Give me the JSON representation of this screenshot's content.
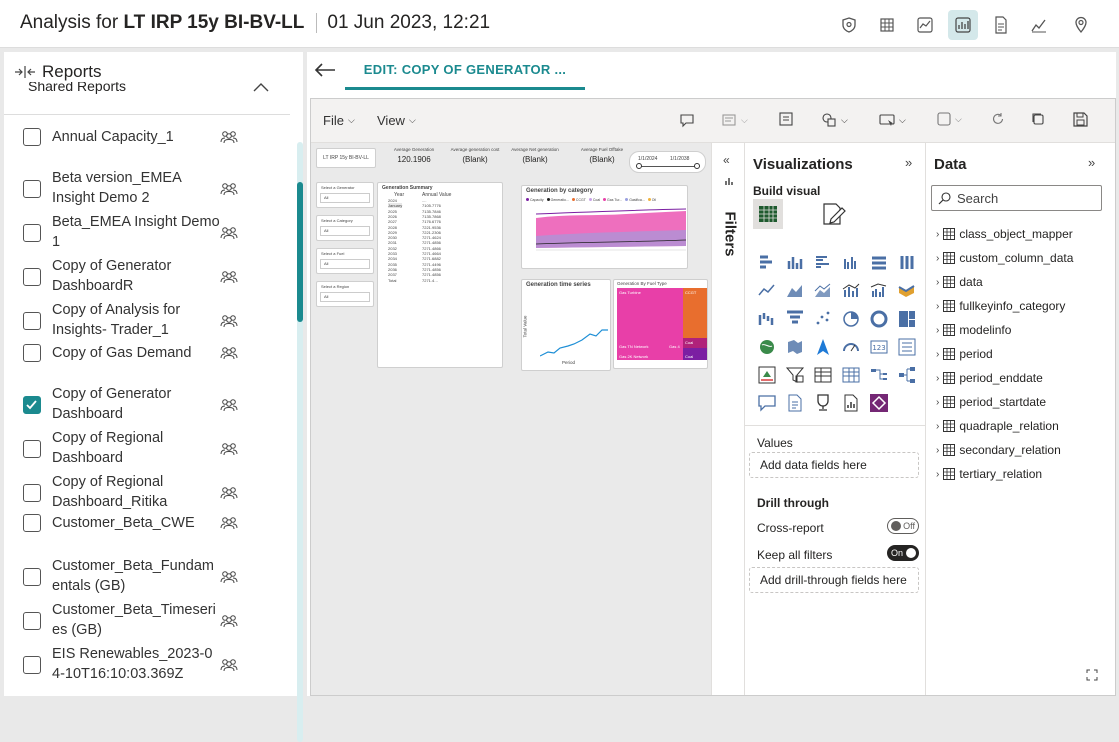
{
  "header": {
    "title_prefix": "Analysis for ",
    "title_bold": "LT IRP 15y BI-BV-LL",
    "timestamp": "01 Jun 2023, 12:21",
    "icons": [
      "shield-pin-icon",
      "table-icon",
      "chart-box-icon",
      "dashboard-icon",
      "document-icon",
      "line-chart-icon",
      "map-pin-icon"
    ]
  },
  "sidebar": {
    "title": "Reports",
    "section": "Shared Reports",
    "items": [
      {
        "label": "Annual Capacity_1",
        "checked": false
      },
      {
        "label": "Beta version_EMEA Insight Demo 2",
        "checked": false
      },
      {
        "label": "Beta_EMEA Insight Demo 1",
        "checked": false
      },
      {
        "label": "Copy of Generator DashboardR",
        "checked": false
      },
      {
        "label": "Copy of Analysis for Insights- Trader_1",
        "checked": false
      },
      {
        "label": "Copy of Gas Demand",
        "checked": false
      },
      {
        "label": "Copy of Generator Dashboard",
        "checked": true
      },
      {
        "label": "Copy of Regional Dashboard",
        "checked": false
      },
      {
        "label": "Copy of Regional Dashboard_Ritika",
        "checked": false
      },
      {
        "label": "Customer_Beta_CWE",
        "checked": false
      },
      {
        "label": "Customer_Beta_Fundamentals (GB)",
        "checked": false
      },
      {
        "label": "Customer_Beta_Timeseries (GB)",
        "checked": false
      },
      {
        "label": "EIS Renewables_2023-04-10T16:10:03.369Z",
        "checked": false
      }
    ]
  },
  "main": {
    "tab_label": "EDIT: COPY OF GENERATOR ...",
    "menu": {
      "file": "File",
      "view": "View"
    },
    "canvas": {
      "report_title": "LT IRP 15y BI-BV-LL",
      "kpis": [
        {
          "label": "Average Generation",
          "value": "120.1906"
        },
        {
          "label": "Average generation cost",
          "value": "(Blank)"
        },
        {
          "label": "Average Net generation",
          "value": "(Blank)"
        },
        {
          "label": "Average Fuel Offtake",
          "value": "(Blank)"
        }
      ],
      "date_from": "1/1/2024",
      "date_to": "1/1/2038",
      "slicers": [
        "Select a Generator",
        "Select a Category",
        "Select a Fuel",
        "Select a Region"
      ],
      "slicer_value": "All",
      "summary_title": "Generation Summary",
      "summary_cols": [
        "Year",
        "Annual Value"
      ],
      "summary_rows": [
        [
          "2024",
          "...."
        ],
        [
          "January",
          "7105.7776"
        ],
        [
          "2025",
          "7135.7846"
        ],
        [
          "2026",
          "7135.7868"
        ],
        [
          "2027",
          "7176.6776"
        ],
        [
          "2028",
          "7221.9536"
        ],
        [
          "2029",
          "7221.2306"
        ],
        [
          "2030",
          "7271.4624"
        ],
        [
          "2031",
          "7271.4856"
        ],
        [
          "2032",
          "7271.4866"
        ],
        [
          "2033",
          "7271.4664"
        ],
        [
          "2034",
          "7271.6882"
        ],
        [
          "2035",
          "7271.4496"
        ],
        [
          "2036",
          "7271.4856"
        ],
        [
          "2037",
          "7271.4856"
        ],
        [
          "Total",
          "7271.4…"
        ]
      ],
      "category_chart_title": "Generation by category",
      "category_legend": [
        "Capacity",
        "Generatio...",
        "CCGT",
        "Coal",
        "Gas Tur...",
        "Gasifica...",
        "Oil"
      ],
      "timeseries_title": "Generation time series",
      "timeseries_ylabel": "Total Value",
      "timeseries_xlabel": "Period",
      "fueltype_title": "Generation By Fuel Type",
      "fueltype_labels": [
        "Gas Turbine",
        "CCGT",
        "Gas TN Network",
        "Gas 2K Network",
        "Gas 4",
        "Coal",
        "Coal"
      ]
    },
    "filters_label": "Filters",
    "visualizations": {
      "title": "Visualizations",
      "build_visual": "Build visual",
      "values_label": "Values",
      "values_drop": "Add data fields here",
      "drill_title": "Drill through",
      "cross_report": "Cross-report",
      "cross_report_state": "Off",
      "keep_filters": "Keep all filters",
      "keep_filters_state": "On",
      "drill_drop": "Add drill-through fields here"
    },
    "data_pane": {
      "title": "Data",
      "search_placeholder": "Search",
      "tables": [
        "class_object_mapper",
        "custom_column_data",
        "data",
        "fullkeyinfo_category",
        "modelinfo",
        "period",
        "period_enddate",
        "period_startdate",
        "quadraple_relation",
        "secondary_relation",
        "tertiary_relation"
      ]
    }
  },
  "colors": {
    "accent": "#1b8a8f",
    "pink": "#e83fa8",
    "purple": "#7b1fa2",
    "orange": "#e86e2e"
  }
}
